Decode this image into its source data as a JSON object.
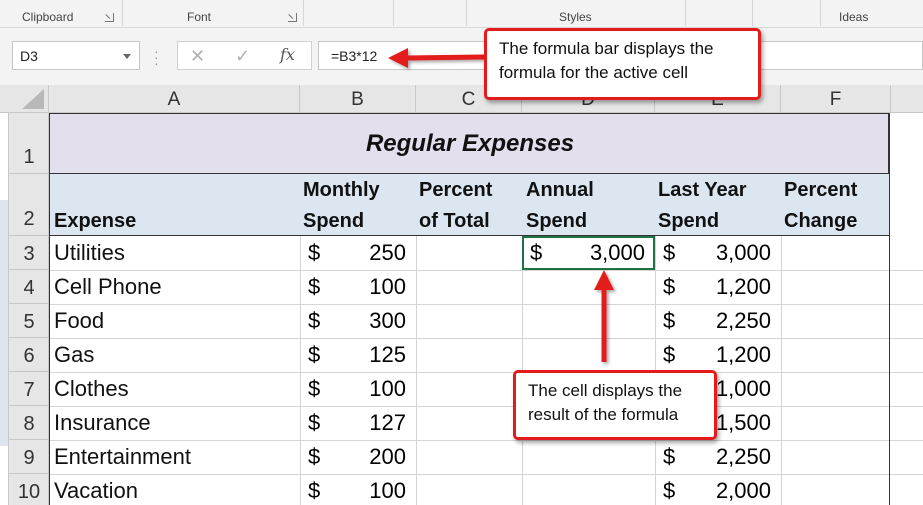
{
  "ribbon": {
    "groups": [
      "Clipboard",
      "Font",
      "Styles",
      "Ideas"
    ]
  },
  "formula_bar": {
    "name_box": "D3",
    "cancel_icon": "close-icon",
    "enter_icon": "check-icon",
    "fx_label": "fx",
    "formula": "=B3*12"
  },
  "columns": [
    "A",
    "B",
    "C",
    "D",
    "E",
    "F"
  ],
  "rows": [
    "1",
    "2",
    "3",
    "4",
    "5",
    "6",
    "7",
    "8",
    "9",
    "10"
  ],
  "sheet": {
    "title": "Regular Expenses",
    "headers": {
      "a": [
        "",
        "Expense"
      ],
      "b": [
        "Monthly",
        "Spend"
      ],
      "c": [
        "Percent",
        "of Total"
      ],
      "d": [
        "Annual",
        "Spend"
      ],
      "e": [
        "Last Year",
        "Spend"
      ],
      "f": [
        "Percent",
        "Change"
      ]
    },
    "currency_symbol": "$",
    "expenses": [
      {
        "name": "Utilities",
        "monthly": "250",
        "annual": "3,000",
        "last_year": "3,000"
      },
      {
        "name": "Cell Phone",
        "monthly": "100",
        "annual": "",
        "last_year": "1,200"
      },
      {
        "name": "Food",
        "monthly": "300",
        "annual": "",
        "last_year": "2,250"
      },
      {
        "name": "Gas",
        "monthly": "125",
        "annual": "",
        "last_year": "1,200"
      },
      {
        "name": "Clothes",
        "monthly": "100",
        "annual": "",
        "last_year": "1,000"
      },
      {
        "name": "Insurance",
        "monthly": "127",
        "annual": "",
        "last_year": "1,500"
      },
      {
        "name": "Entertainment",
        "monthly": "200",
        "annual": "",
        "last_year": "2,250"
      },
      {
        "name": "Vacation",
        "monthly": "100",
        "annual": "",
        "last_year": "2,000"
      }
    ]
  },
  "callouts": {
    "formula_bar": "The formula bar displays the formula for the active cell",
    "cell": "The cell displays the result of the formula"
  },
  "colors": {
    "annotation_red": "#e31b1b",
    "title_fill": "#e4dfec",
    "header_fill": "#dce6f1",
    "active_cell_border": "#217346"
  }
}
